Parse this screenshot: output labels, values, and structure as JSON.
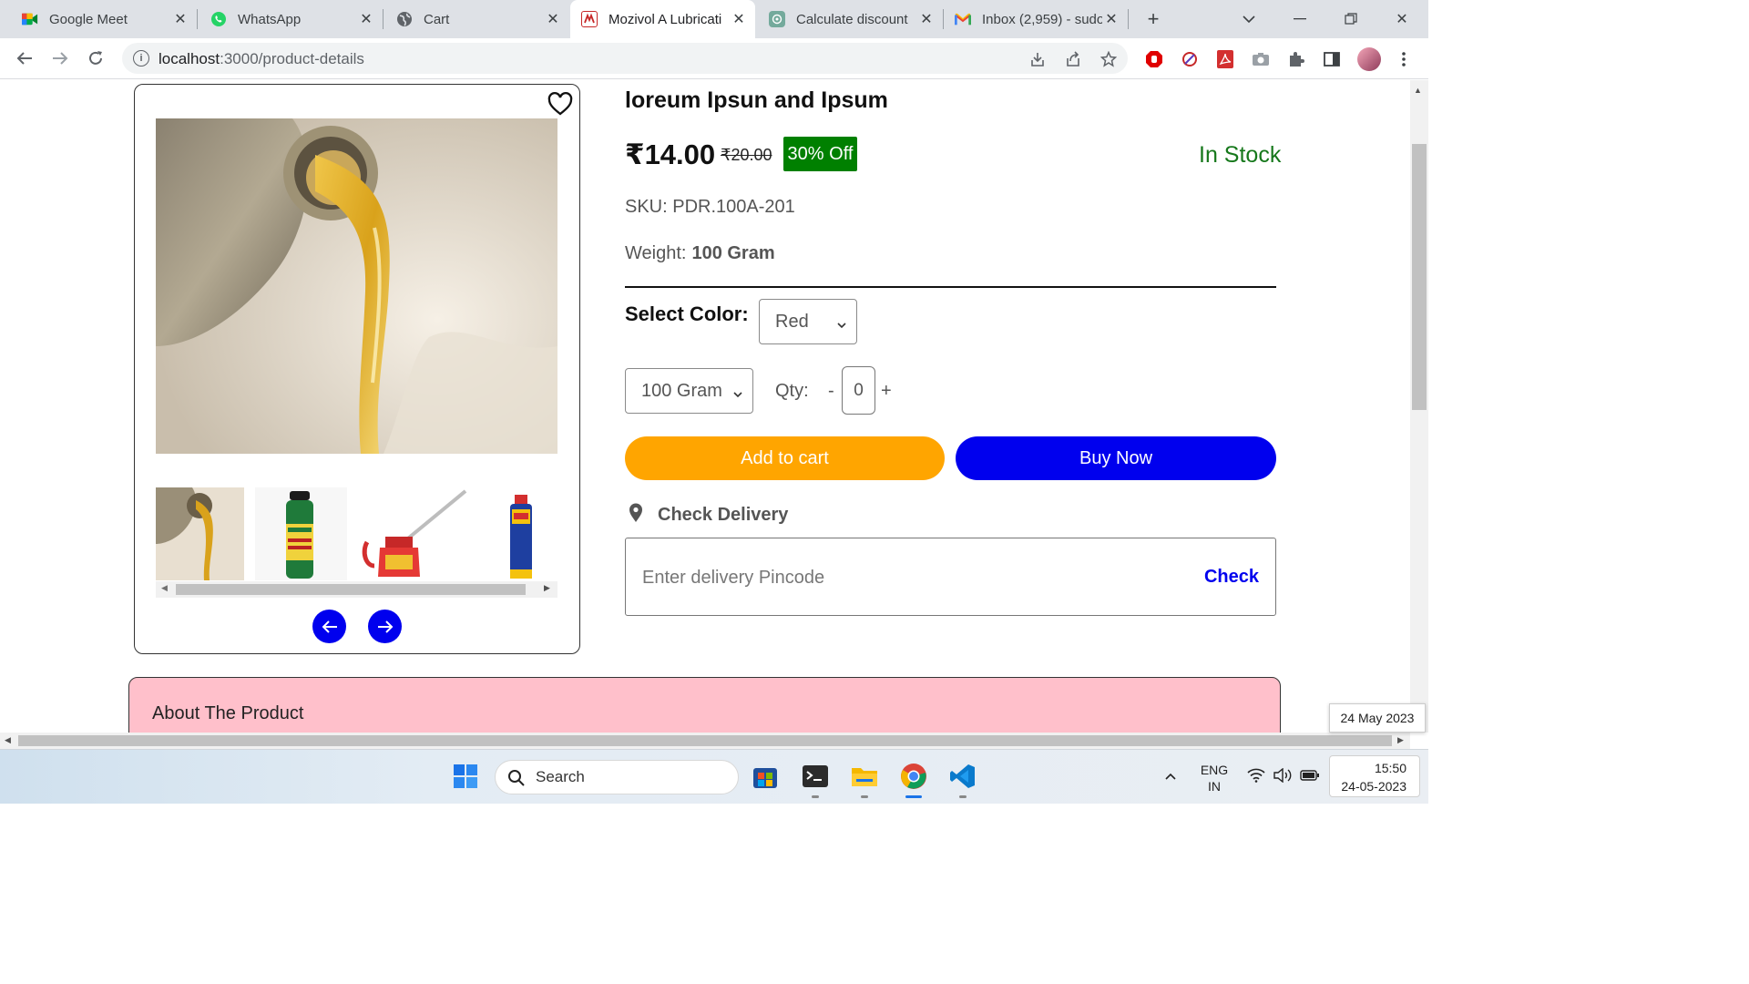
{
  "browser": {
    "tabs": [
      {
        "title": "Google Meet",
        "icon": "google-meet-icon",
        "active": false
      },
      {
        "title": "WhatsApp",
        "icon": "whatsapp-icon",
        "active": false
      },
      {
        "title": "Cart",
        "icon": "globe-icon",
        "active": false
      },
      {
        "title": "Mozivol A Lubricati",
        "icon": "mozivol-icon",
        "active": true
      },
      {
        "title": "Calculate discount",
        "icon": "chatgpt-icon",
        "active": false
      },
      {
        "title": "Inbox (2,959) - sudo",
        "icon": "gmail-icon",
        "active": false
      }
    ],
    "url_host": "localhost",
    "url_path": ":3000/product-details"
  },
  "product": {
    "title": "loreum Ipsun and Ipsum",
    "price": "₹14.00",
    "old_price": "₹20.00",
    "discount": "30% Off",
    "stock": "In Stock",
    "sku": "SKU: PDR.100A-201",
    "weight_label": "Weight:",
    "weight_value": "100 Gram",
    "color_label": "Select Color:",
    "color_selected": "Red",
    "size_selected": "100 Gram",
    "qty_label": "Qty:",
    "qty_minus": "-",
    "qty_value": "0",
    "qty_plus": "+",
    "add_to_cart": "Add to cart",
    "buy_now": "Buy Now",
    "check_delivery": "Check Delivery",
    "pincode_placeholder": "Enter delivery Pincode",
    "check": "Check",
    "about": "About The Product"
  },
  "thumbnails": [
    "oil-pour-thumbnail",
    "graphite-lubricant-can-thumbnail",
    "oil-can-thumbnail",
    "wd40-can-thumbnail"
  ],
  "tooltip_date": "24 May 2023",
  "taskbar": {
    "search": "Search",
    "lang_top": "ENG",
    "lang_bottom": "IN",
    "time": "15:50",
    "date": "24-05-2023"
  },
  "colors": {
    "add_to_cart": "#ffa500",
    "buy_now": "#0000ee",
    "discount_badge": "#008000",
    "in_stock": "#16781b",
    "about_bg": "#ffc0cb"
  }
}
